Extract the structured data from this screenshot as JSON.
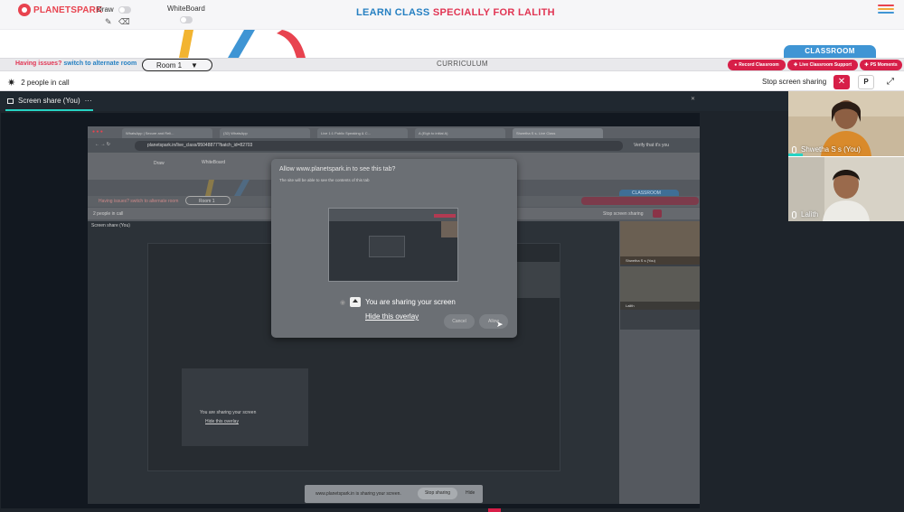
{
  "brand": {
    "logo_text": "PLANETSPARK",
    "colors": {
      "brand_red": "#e8434f",
      "accent_blue": "#2680c2",
      "accent_red": "#e13553",
      "action_red": "#d71f48",
      "classroom_blue": "#3f95d4",
      "active_teal": "#27d3c4"
    }
  },
  "header": {
    "draw_label": "Draw",
    "whiteboard_label": "WhiteBoard",
    "title_part1": "LEARN CLASS",
    "title_part2": "SPECIALLY FOR LALITH",
    "icons": [
      "pencil-icon",
      "eraser-icon",
      "hamburger-menu-icon"
    ]
  },
  "classroom_tab": "CLASSROOM",
  "infobar": {
    "issues_prefix": "Having issues?",
    "issues_link": "switch to alternate room",
    "room_value": "Room 1",
    "curriculum_label": "CURRICULUM",
    "buttons": {
      "record": "Record Classroom",
      "support": "Live Classroom Support",
      "moments": "PS Moments"
    }
  },
  "callbar": {
    "people_count_text": "2 people in call",
    "stop_sharing_label": "Stop screen sharing",
    "stop_icon": "✕",
    "pin_label": "P",
    "expand_icon": "⤢"
  },
  "share": {
    "title": "Screen share (You)",
    "more": "···"
  },
  "nested": {
    "tabs": [
      "WhatsApp | Secure and Reli...",
      "(32) WhatsApp",
      "Live 1:1 Public Speaking & C...",
      "A (Eigh to initial A)",
      "Shwetha S s- Live Class"
    ],
    "url": "planetspark.in/live_class/95048877?batch_id=82703",
    "verify": "Verify that it's you",
    "draw": "Draw",
    "whiteboard": "WhiteBoard",
    "issues": "Having issues?  switch to alternate room",
    "room": "Room 1",
    "classroom": "CLASSROOM",
    "people": "2 people in call",
    "stop": "Stop screen sharing",
    "share_title": "Screen share (You)",
    "tile1": "Shwetha S s (You)",
    "tile2": "Lalith",
    "inner_sharing": "You are sharing your screen",
    "inner_hide": "Hide this overlay"
  },
  "dialog": {
    "title": "Allow www.planetspark.in to see this tab?",
    "subtitle": "The site will be able to see the contents of this tab",
    "cancel": "Cancel",
    "allow": "Allow"
  },
  "overlay": {
    "sharing_text": "You are sharing your screen",
    "hide_text": "Hide this overlay"
  },
  "bottom_bar": {
    "text": "www.planetspark.in is sharing your screen.",
    "stop": "Stop sharing",
    "hide": "Hide"
  },
  "participants": [
    {
      "name": "Shwetha S s (You)"
    },
    {
      "name": "Lalith"
    }
  ]
}
